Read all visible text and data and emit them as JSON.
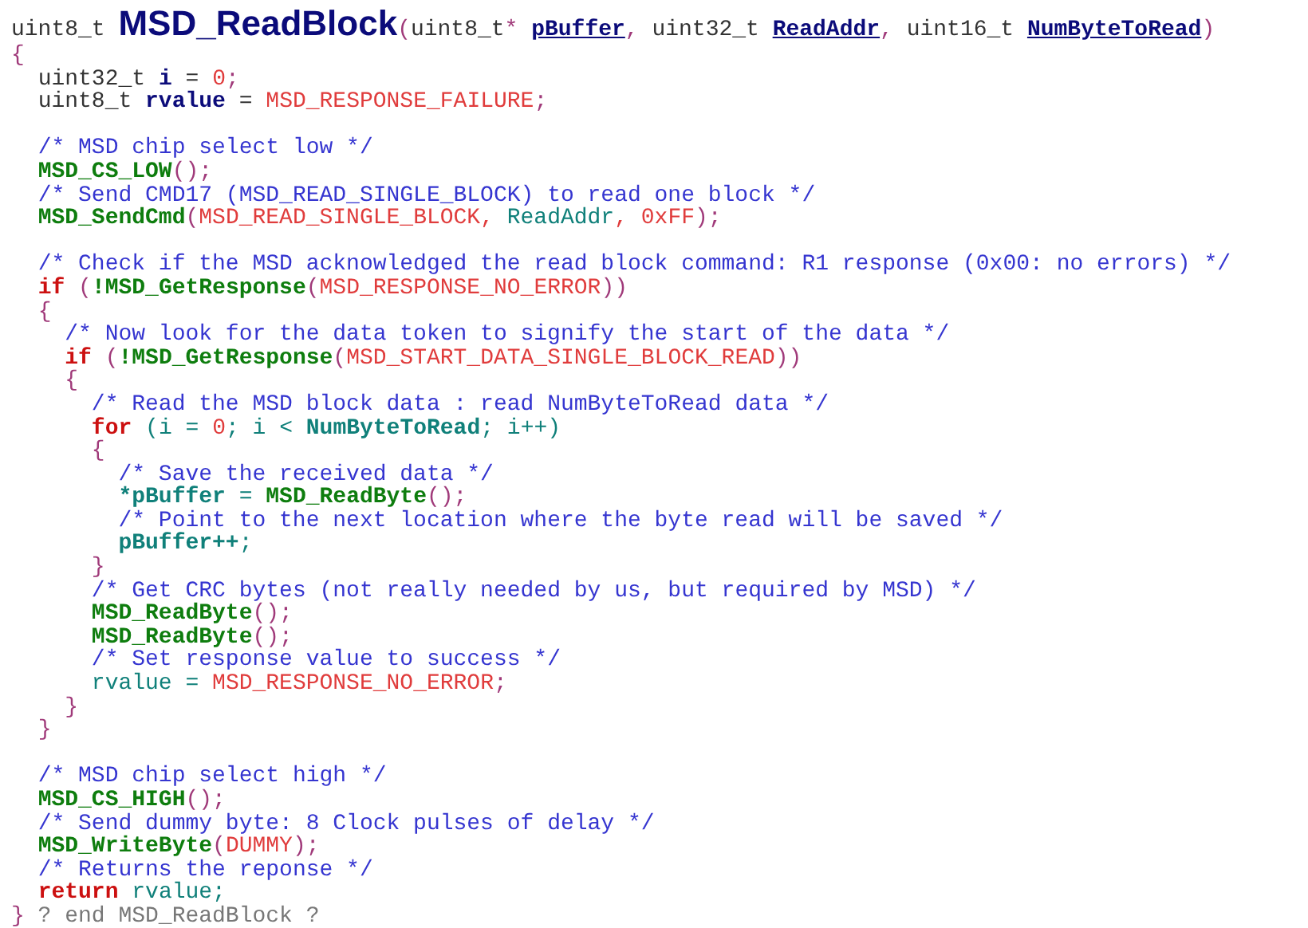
{
  "listing": {
    "lines": [
      {
        "kind": "signature",
        "tokens": [
          {
            "kind": "type",
            "text": "uint8_t "
          },
          {
            "kind": "title",
            "text": "MSD_ReadBlock"
          },
          {
            "kind": "punct",
            "text": "("
          },
          {
            "kind": "type",
            "text": "uint8_t"
          },
          {
            "kind": "punct",
            "text": "* "
          },
          {
            "kind": "param",
            "text": "pBuffer"
          },
          {
            "kind": "punct",
            "text": ","
          },
          {
            "kind": "type",
            "text": " uint32_t "
          },
          {
            "kind": "param",
            "text": "ReadAddr"
          },
          {
            "kind": "punct",
            "text": ","
          },
          {
            "kind": "type",
            "text": " uint16_t "
          },
          {
            "kind": "param",
            "text": "NumByteToRead"
          },
          {
            "kind": "punct",
            "text": ")"
          }
        ]
      },
      {
        "kind": "code",
        "tokens": [
          {
            "kind": "punct",
            "text": "{"
          }
        ]
      },
      {
        "kind": "code",
        "tokens": [
          {
            "kind": "type",
            "text": "  uint32_t "
          },
          {
            "kind": "decl",
            "text": "i"
          },
          {
            "kind": "type",
            "text": " = "
          },
          {
            "kind": "number",
            "text": "0"
          },
          {
            "kind": "punct",
            "text": ";"
          }
        ]
      },
      {
        "kind": "code",
        "tokens": [
          {
            "kind": "type",
            "text": "  uint8_t "
          },
          {
            "kind": "decl",
            "text": "rvalue"
          },
          {
            "kind": "type",
            "text": " = "
          },
          {
            "kind": "macro",
            "text": "MSD_RESPONSE_FAILURE"
          },
          {
            "kind": "punct",
            "text": ";"
          }
        ]
      },
      {
        "kind": "blank"
      },
      {
        "kind": "code",
        "tokens": [
          {
            "kind": "comment",
            "text": "  /* MSD chip select low */"
          }
        ]
      },
      {
        "kind": "code",
        "tokens": [
          {
            "kind": "func",
            "text": "  MSD_CS_LOW"
          },
          {
            "kind": "punct",
            "text": "();"
          }
        ]
      },
      {
        "kind": "code",
        "tokens": [
          {
            "kind": "comment",
            "text": "  /* Send CMD17 (MSD_READ_SINGLE_BLOCK) to read one block */"
          }
        ]
      },
      {
        "kind": "code",
        "tokens": [
          {
            "kind": "func",
            "text": "  MSD_SendCmd"
          },
          {
            "kind": "punct",
            "text": "("
          },
          {
            "kind": "macro",
            "text": "MSD_READ_SINGLE_BLOCK, "
          },
          {
            "kind": "var",
            "text": "ReadAddr"
          },
          {
            "kind": "macro",
            "text": ", 0xFF"
          },
          {
            "kind": "punct",
            "text": ");"
          }
        ]
      },
      {
        "kind": "blank"
      },
      {
        "kind": "code",
        "tokens": [
          {
            "kind": "comment",
            "text": "  /* Check if the MSD acknowledged the read block command: R1 response (0x00: no errors) */"
          }
        ]
      },
      {
        "kind": "code",
        "tokens": [
          {
            "kind": "keyword",
            "text": "  if"
          },
          {
            "kind": "punct",
            "text": " ("
          },
          {
            "kind": "func",
            "text": "!MSD_GetResponse"
          },
          {
            "kind": "punct",
            "text": "("
          },
          {
            "kind": "macro",
            "text": "MSD_RESPONSE_NO_ERROR"
          },
          {
            "kind": "punct",
            "text": "))"
          }
        ]
      },
      {
        "kind": "code",
        "tokens": [
          {
            "kind": "punct",
            "text": "  {"
          }
        ]
      },
      {
        "kind": "code",
        "tokens": [
          {
            "kind": "comment",
            "text": "    /* Now look for the data token to signify the start of the data */"
          }
        ]
      },
      {
        "kind": "code",
        "tokens": [
          {
            "kind": "keyword",
            "text": "    if"
          },
          {
            "kind": "punct",
            "text": " ("
          },
          {
            "kind": "func",
            "text": "!MSD_GetResponse"
          },
          {
            "kind": "punct",
            "text": "("
          },
          {
            "kind": "macro",
            "text": "MSD_START_DATA_SINGLE_BLOCK_READ"
          },
          {
            "kind": "punct",
            "text": "))"
          }
        ]
      },
      {
        "kind": "code",
        "tokens": [
          {
            "kind": "punct",
            "text": "    {"
          }
        ]
      },
      {
        "kind": "code",
        "tokens": [
          {
            "kind": "comment",
            "text": "      /* Read the MSD block data : read NumByteToRead data */"
          }
        ]
      },
      {
        "kind": "code",
        "tokens": [
          {
            "kind": "keyword",
            "text": "      for"
          },
          {
            "kind": "var",
            "text": " (i = "
          },
          {
            "kind": "number",
            "text": "0"
          },
          {
            "kind": "var",
            "text": "; i < "
          },
          {
            "kind": "varb",
            "text": "NumByteToRead"
          },
          {
            "kind": "var",
            "text": "; i++)"
          }
        ]
      },
      {
        "kind": "code",
        "tokens": [
          {
            "kind": "punct",
            "text": "      {"
          }
        ]
      },
      {
        "kind": "code",
        "tokens": [
          {
            "kind": "comment",
            "text": "        /* Save the received data */"
          }
        ]
      },
      {
        "kind": "code",
        "tokens": [
          {
            "kind": "varb",
            "text": "        *pBuffer"
          },
          {
            "kind": "var",
            "text": " = "
          },
          {
            "kind": "func",
            "text": "MSD_ReadByte"
          },
          {
            "kind": "punct",
            "text": "();"
          }
        ]
      },
      {
        "kind": "code",
        "tokens": [
          {
            "kind": "comment",
            "text": "        /* Point to the next location where the byte read will be saved */"
          }
        ]
      },
      {
        "kind": "code",
        "tokens": [
          {
            "kind": "varb",
            "text": "        pBuffer++"
          },
          {
            "kind": "var",
            "text": ";"
          }
        ]
      },
      {
        "kind": "code",
        "tokens": [
          {
            "kind": "punct",
            "text": "      }"
          }
        ]
      },
      {
        "kind": "code",
        "tokens": [
          {
            "kind": "comment",
            "text": "      /* Get CRC bytes (not really needed by us, but required by MSD) */"
          }
        ]
      },
      {
        "kind": "code",
        "tokens": [
          {
            "kind": "func",
            "text": "      MSD_ReadByte"
          },
          {
            "kind": "punct",
            "text": "();"
          }
        ]
      },
      {
        "kind": "code",
        "tokens": [
          {
            "kind": "func",
            "text": "      MSD_ReadByte"
          },
          {
            "kind": "punct",
            "text": "();"
          }
        ]
      },
      {
        "kind": "code",
        "tokens": [
          {
            "kind": "comment",
            "text": "      /* Set response value to success */"
          }
        ]
      },
      {
        "kind": "code",
        "tokens": [
          {
            "kind": "var",
            "text": "      rvalue = "
          },
          {
            "kind": "macro",
            "text": "MSD_RESPONSE_NO_ERROR"
          },
          {
            "kind": "punct",
            "text": ";"
          }
        ]
      },
      {
        "kind": "code",
        "tokens": [
          {
            "kind": "punct",
            "text": "    }"
          }
        ]
      },
      {
        "kind": "code",
        "tokens": [
          {
            "kind": "punct",
            "text": "  }"
          }
        ]
      },
      {
        "kind": "blank"
      },
      {
        "kind": "code",
        "tokens": [
          {
            "kind": "comment",
            "text": "  /* MSD chip select high */"
          }
        ]
      },
      {
        "kind": "code",
        "tokens": [
          {
            "kind": "func",
            "text": "  MSD_CS_HIGH"
          },
          {
            "kind": "punct",
            "text": "();"
          }
        ]
      },
      {
        "kind": "code",
        "tokens": [
          {
            "kind": "comment",
            "text": "  /* Send dummy byte: 8 Clock pulses of delay */"
          }
        ]
      },
      {
        "kind": "code",
        "tokens": [
          {
            "kind": "func",
            "text": "  MSD_WriteByte"
          },
          {
            "kind": "punct",
            "text": "("
          },
          {
            "kind": "macro",
            "text": "DUMMY"
          },
          {
            "kind": "punct",
            "text": ");"
          }
        ]
      },
      {
        "kind": "code",
        "tokens": [
          {
            "kind": "comment",
            "text": "  /* Returns the reponse */"
          }
        ]
      },
      {
        "kind": "code",
        "tokens": [
          {
            "kind": "keyword",
            "text": "  return"
          },
          {
            "kind": "var",
            "text": " rvalue;"
          }
        ]
      },
      {
        "kind": "code",
        "tokens": [
          {
            "kind": "punct",
            "text": "}"
          },
          {
            "kind": "end",
            "text": " ? end MSD_ReadBlock ?"
          }
        ]
      }
    ]
  }
}
